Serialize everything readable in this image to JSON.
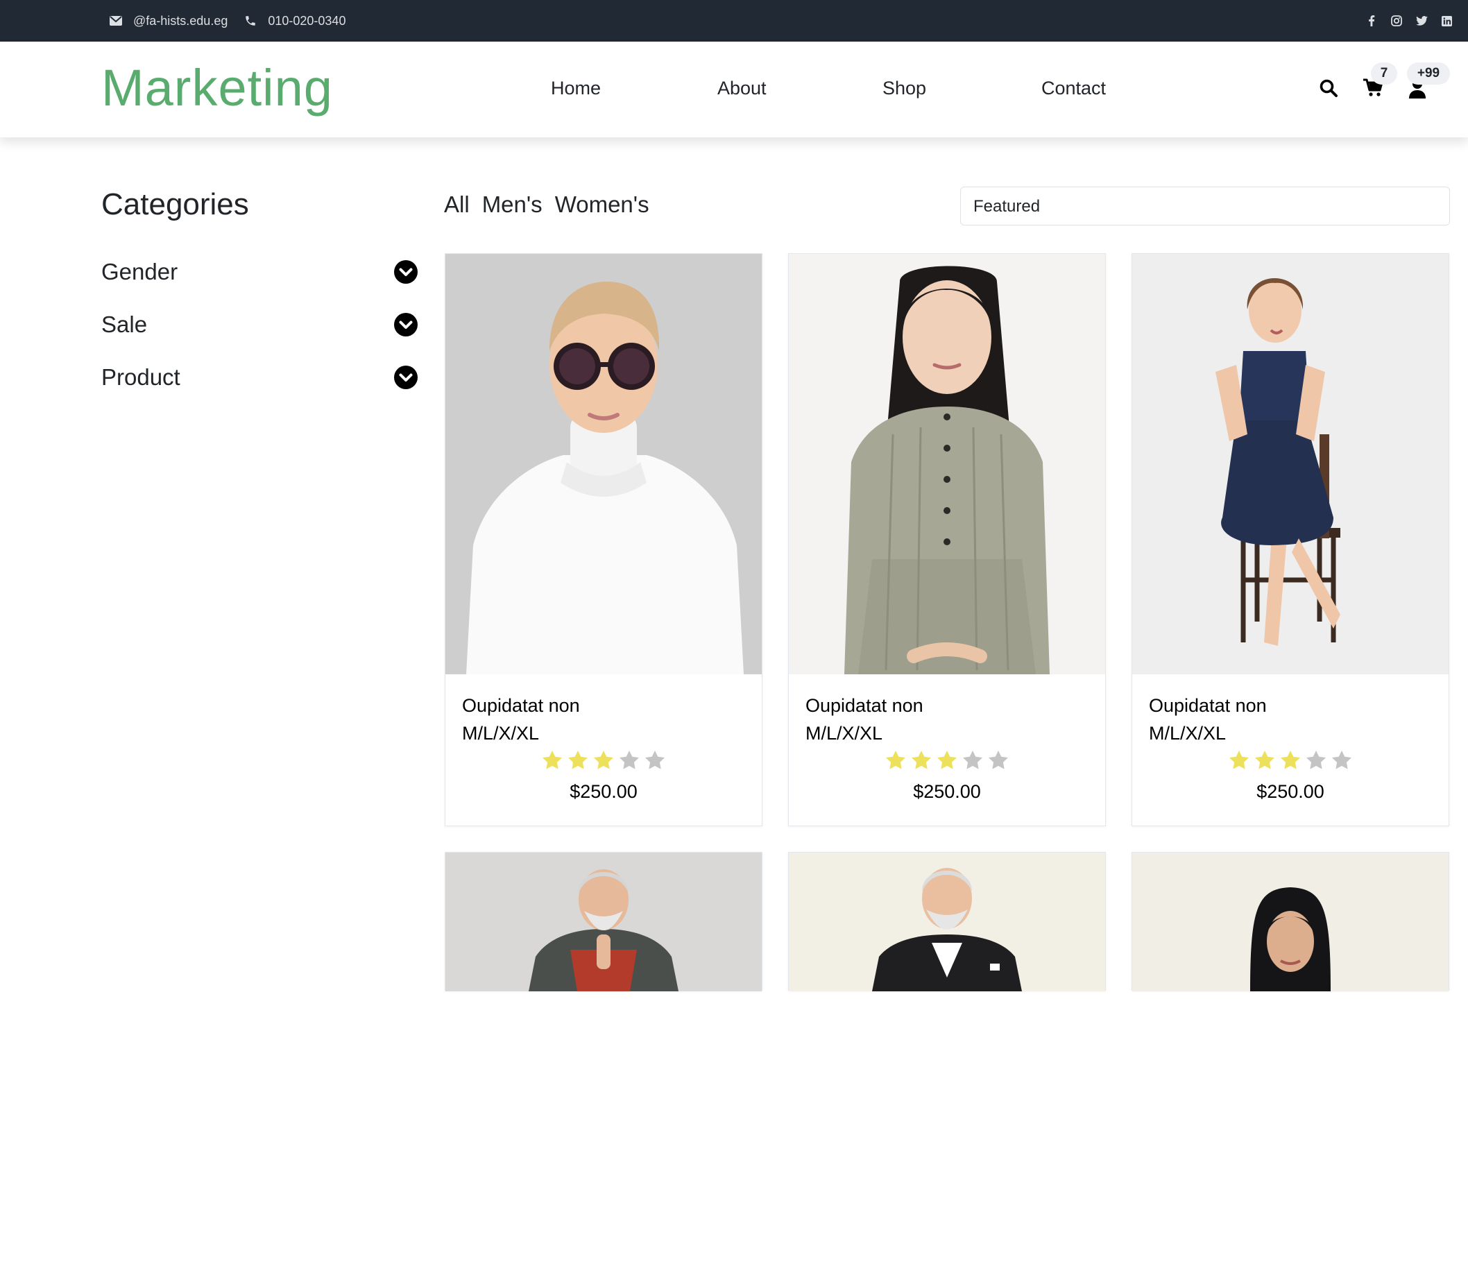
{
  "topbar": {
    "email": "@fa-hists.edu.eg",
    "phone": "010-020-0340",
    "email_icon": "envelope-icon",
    "phone_icon": "phone-icon",
    "social": [
      "facebook-icon",
      "instagram-icon",
      "twitter-icon",
      "linkedin-icon"
    ]
  },
  "header": {
    "brand": "Marketing",
    "nav": [
      "Home",
      "About",
      "Shop",
      "Contact"
    ],
    "cart_count": "7",
    "user_count": "+99"
  },
  "sidebar": {
    "title": "Categories",
    "items": [
      {
        "label": "Gender"
      },
      {
        "label": "Sale"
      },
      {
        "label": "Product"
      }
    ]
  },
  "filters": {
    "tabs": [
      "All",
      "Men's",
      "Women's"
    ],
    "sort_selected": "Featured"
  },
  "products": [
    {
      "name": "Oupidatat non",
      "sizes": "M/L/X/XL",
      "rating": 3,
      "max_rating": 5,
      "price": "$250.00"
    },
    {
      "name": "Oupidatat non",
      "sizes": "M/L/X/XL",
      "rating": 3,
      "max_rating": 5,
      "price": "$250.00"
    },
    {
      "name": "Oupidatat non",
      "sizes": "M/L/X/XL",
      "rating": 3,
      "max_rating": 5,
      "price": "$250.00"
    },
    {
      "name": "",
      "sizes": "",
      "rating": 0,
      "max_rating": 0,
      "price": ""
    },
    {
      "name": "",
      "sizes": "",
      "rating": 0,
      "max_rating": 0,
      "price": ""
    },
    {
      "name": "",
      "sizes": "",
      "rating": 0,
      "max_rating": 0,
      "price": ""
    }
  ],
  "colors": {
    "brand": "#59ab6e",
    "topbar_bg": "#212934",
    "star_filled": "#ede15b",
    "star_empty": "#c4c4c4"
  }
}
